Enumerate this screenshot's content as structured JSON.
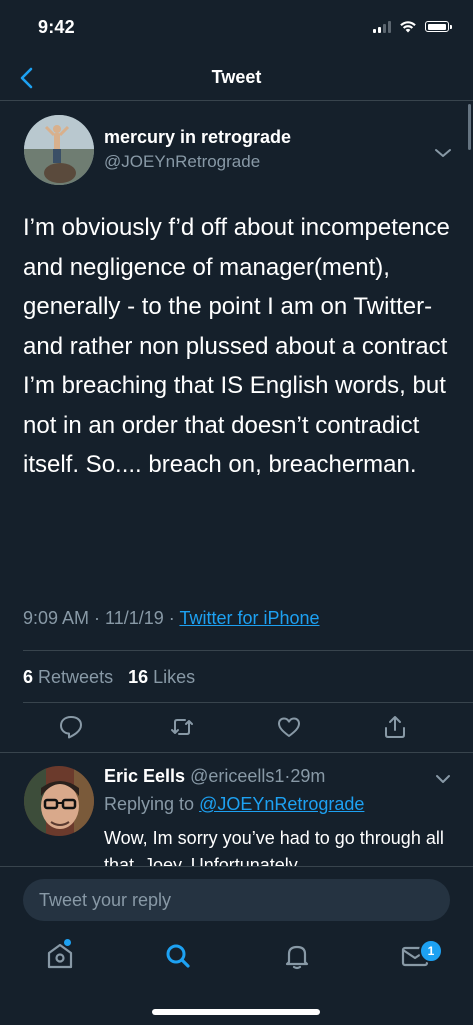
{
  "status_bar": {
    "time": "9:42"
  },
  "nav": {
    "title": "Tweet"
  },
  "tweet": {
    "author_name": "mercury in retrograde",
    "author_handle": "@JOEYnRetrograde",
    "text": "I’m obviously f’d off about incompetence and negligence of manager(ment), generally -  to the point I am on Twitter- and rather non plussed about a contract I’m breaching that IS English words, but not in an order that doesn’t contradict itself. So.... breach on, breacherman.",
    "time": "9:09 AM",
    "date": "11/1/19",
    "separator": " · ",
    "source": "Twitter for iPhone",
    "retweets_count": "6",
    "retweets_label": "Retweets",
    "likes_count": "16",
    "likes_label": "Likes"
  },
  "reply": {
    "name": "Eric Eells",
    "handle": "@ericeells1",
    "dot": "·",
    "age": "29m",
    "replying_prefix": "Replying to ",
    "replying_to": "@JOEYnRetrograde",
    "text": "Wow, Im sorry you’ve had to go through all that, Joey. Unfortunately"
  },
  "composer": {
    "placeholder": "Tweet your reply"
  },
  "tabs": {
    "messages_badge": "1"
  },
  "colors": {
    "background": "#15202b",
    "accent": "#1da1f2",
    "secondary_text": "#8899a6",
    "divider": "#38444d"
  },
  "icons": [
    "back-chevron-icon",
    "chevron-down-icon",
    "reply-icon",
    "retweet-icon",
    "like-icon",
    "share-icon",
    "home-icon",
    "search-icon",
    "notifications-icon",
    "messages-icon"
  ]
}
